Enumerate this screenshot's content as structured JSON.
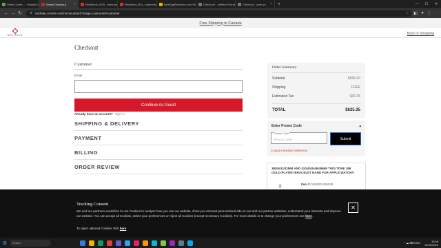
{
  "browser": {
    "tabs": [
      {
        "title": "Verify Codes — SimplyCodes",
        "color": "#4caf50",
        "active": false
      },
      {
        "title": "Guest Checkout",
        "color": "#c62828",
        "active": true
      },
      {
        "title": "Recibidos (478) - personal92@gmail.com",
        "color": "#d93025",
        "active": false
      },
      {
        "title": "Recibidos (33) - partnerworks@gmail.com",
        "color": "#d93025",
        "active": false
      },
      {
        "title": "NewEggBusiness.com Shopping Cart",
        "color": "#f2a900",
        "active": false
      },
      {
        "title": "Checkout - Jeffrey's Horse and Stuff",
        "color": "#777777",
        "active": false
      },
      {
        "title": "Checkout - jane-yo",
        "color": "#777777",
        "active": false
      }
    ],
    "new_tab": "+",
    "url": "michele.com/en-us/checkoutstart/?stage=customer#customer",
    "win_controls": [
      "—",
      "☐",
      "✕"
    ]
  },
  "promo_bar": "Free Shipping to Canada",
  "header": {
    "logo_text": "MICHELE",
    "back_link": "Back to Shopping"
  },
  "checkout": {
    "title": "Checkout",
    "customer_heading": "Customer",
    "email_label": "Email",
    "email_value": "",
    "guest_button": "Continue As Guest",
    "account_question": "Already have an account?",
    "sign_in": "Sign in",
    "sections": [
      "SHIPPING & DELIVERY",
      "PAYMENT",
      "BILLING",
      "ORDER REVIEW"
    ]
  },
  "summary": {
    "title": "Order Summary",
    "rows": [
      {
        "label": "Subtotal",
        "value": "$595.00"
      },
      {
        "label": "Shipping",
        "value": "FREE"
      },
      {
        "label": "Estimated Tax",
        "value": "$30.35"
      }
    ],
    "total_label": "TOTAL",
    "total_value": "$625.35"
  },
  "promo": {
    "title": "Enter Promo Code",
    "toggle": "▴",
    "field_label": "Promo Code",
    "placeholder": "Promo Code",
    "submit": "Submit",
    "message": "Coupon already redeemed"
  },
  "product": {
    "name": "38/40/41/42MM AND 42/44/45/46/49MM TWO-TONE 18K GOLD-PLATED BRACELET BAND FOR APPLE WATCH®",
    "item_label": "Item #:",
    "item_number": "MS20DL285048"
  },
  "cookie": {
    "title": "Tracking Consent",
    "body": "We and our partners would like to use Cookies to analyse how you use our website, show you relevant personalised ads on our and our partner websites, understand your interests and improve our website. You can accept all Cookies, select your preferences or reject all Cookies (except necessary Cookies). For more details or to change your preferences see",
    "here": "here",
    "reject_text": "To reject optional Cookies click",
    "close": "✕"
  },
  "taskbar": {
    "search": "Search",
    "icon_colors": [
      "#3a7bd5",
      "#f4b400",
      "#0f9d58",
      "#db4437",
      "#6a5acd",
      "#2ea3f2",
      "#e91e63",
      "#ff9800",
      "#00bcd4",
      "#8bc34a",
      "#9c27b0",
      "#607d8b",
      "#03a9f4"
    ],
    "tray": "^ ☁ ⌨ ENG",
    "time": "18:48",
    "date": "12/02/2025"
  }
}
